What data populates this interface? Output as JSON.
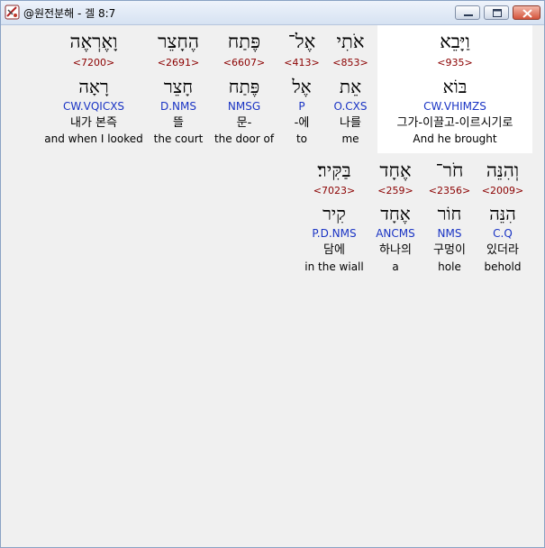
{
  "window": {
    "title": "@원전분해 - 겔 8:7",
    "controls": {
      "minimize": "minimize",
      "maximize": "maximize",
      "close": "close"
    }
  },
  "words": [
    {
      "hebrew": "וַיָּבֵא",
      "strong": "<935>",
      "lemma": "בּוֹא",
      "morph": "CW.VHIMZS",
      "korean": "그가-이끌고-이르시기로",
      "english": "And he brought",
      "selected": true
    },
    {
      "hebrew": "אֹתִי",
      "strong": "<853>",
      "lemma": "אֵת",
      "morph": "O.CXS",
      "korean": "나를",
      "english": "me",
      "selected": false
    },
    {
      "hebrew": "אֶל־",
      "strong": "<413>",
      "lemma": "אֶל",
      "morph": "P",
      "korean": "-에",
      "english": "to",
      "selected": false
    },
    {
      "hebrew": "פֶּתַח",
      "strong": "<6607>",
      "lemma": "פֶּתַח",
      "morph": "NMSG",
      "korean": "문-",
      "english": "the door of",
      "selected": false
    },
    {
      "hebrew": "הֶחָצֵר",
      "strong": "<2691>",
      "lemma": "חָצֵר",
      "morph": "D.NMS",
      "korean": "뜰",
      "english": "the court",
      "selected": false
    },
    {
      "hebrew": "וָאֶרְאֶה",
      "strong": "<7200>",
      "lemma": "רָאָה",
      "morph": "CW.VQICXS",
      "korean": "내가 본즉",
      "english": "and when I looked",
      "selected": false
    },
    {
      "hebrew": "וְהִנֵּה",
      "strong": "<2009>",
      "lemma": "הִנֵּה",
      "morph": "C.Q",
      "korean": "있더라",
      "english": "behold",
      "selected": false
    },
    {
      "hebrew": "חֹר־",
      "strong": "<2356>",
      "lemma": "חוֹר",
      "morph": "NMS",
      "korean": "구멍이",
      "english": "hole",
      "selected": false
    },
    {
      "hebrew": "אֶחָד",
      "strong": "<259>",
      "lemma": "אֶחָד",
      "morph": "ANCMS",
      "korean": "하나의",
      "english": "a",
      "selected": false
    },
    {
      "hebrew": "בַּקִּיר׃",
      "strong": "<7023>",
      "lemma": "קִיר",
      "morph": "P.D.NMS",
      "korean": "담에",
      "english": "in the wiall",
      "selected": false
    }
  ],
  "colors": {
    "strong": "#8b0000",
    "morph": "#1a34c4",
    "selected_background": "#ffffff",
    "content_background": "#f0f0f0"
  }
}
